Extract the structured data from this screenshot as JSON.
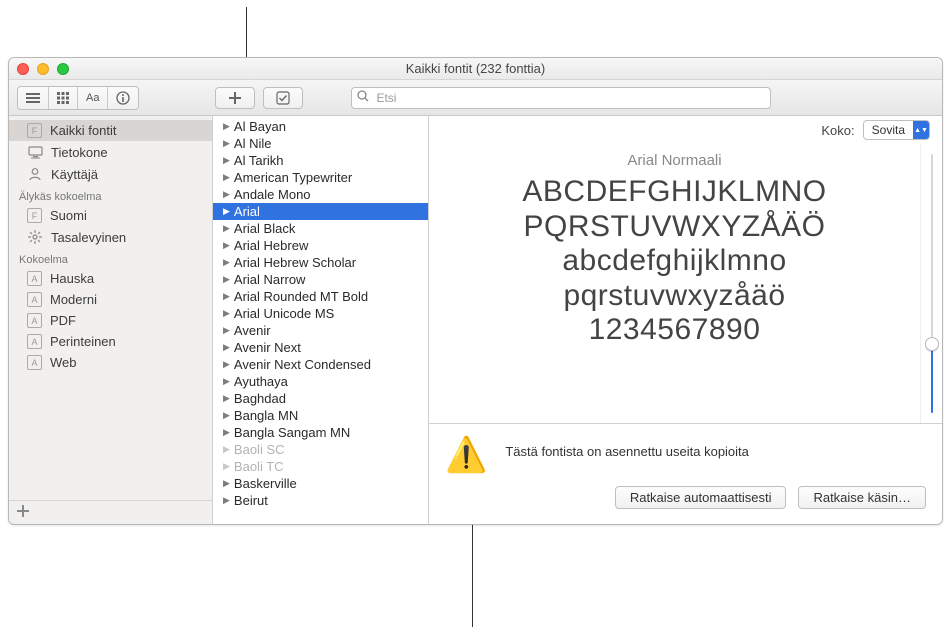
{
  "window": {
    "title": "Kaikki fontit (232 fonttia)"
  },
  "toolbar": {
    "search_placeholder": "Etsi"
  },
  "sidebar": {
    "groups": [
      {
        "header": null,
        "items": [
          {
            "icon": "F",
            "label": "Kaikki fontit",
            "selected": true,
            "name": "sidebar-item-all-fonts"
          },
          {
            "icon": "display",
            "label": "Tietokone",
            "name": "sidebar-item-computer"
          },
          {
            "icon": "user",
            "label": "Käyttäjä",
            "name": "sidebar-item-user"
          }
        ]
      },
      {
        "header": "Älykäs kokoelma",
        "items": [
          {
            "icon": "F",
            "label": "Suomi",
            "name": "sidebar-item-suomi"
          },
          {
            "icon": "gear",
            "label": "Tasalevyinen",
            "name": "sidebar-item-fixed-width"
          }
        ]
      },
      {
        "header": "Kokoelma",
        "items": [
          {
            "icon": "A",
            "label": "Hauska",
            "name": "sidebar-item-fun"
          },
          {
            "icon": "A",
            "label": "Moderni",
            "name": "sidebar-item-modern"
          },
          {
            "icon": "A",
            "label": "PDF",
            "name": "sidebar-item-pdf"
          },
          {
            "icon": "A",
            "label": "Perinteinen",
            "name": "sidebar-item-traditional"
          },
          {
            "icon": "A",
            "label": "Web",
            "name": "sidebar-item-web"
          }
        ]
      }
    ]
  },
  "fonts": [
    {
      "name": "Al Bayan"
    },
    {
      "name": "Al Nile"
    },
    {
      "name": "Al Tarikh"
    },
    {
      "name": "American Typewriter"
    },
    {
      "name": "Andale Mono"
    },
    {
      "name": "Arial",
      "selected": true
    },
    {
      "name": "Arial Black"
    },
    {
      "name": "Arial Hebrew"
    },
    {
      "name": "Arial Hebrew Scholar"
    },
    {
      "name": "Arial Narrow"
    },
    {
      "name": "Arial Rounded MT Bold"
    },
    {
      "name": "Arial Unicode MS"
    },
    {
      "name": "Avenir"
    },
    {
      "name": "Avenir Next"
    },
    {
      "name": "Avenir Next Condensed"
    },
    {
      "name": "Ayuthaya"
    },
    {
      "name": "Baghdad"
    },
    {
      "name": "Bangla MN"
    },
    {
      "name": "Bangla Sangam MN"
    },
    {
      "name": "Baoli SC",
      "disabled": true
    },
    {
      "name": "Baoli TC",
      "disabled": true
    },
    {
      "name": "Baskerville"
    },
    {
      "name": "Beirut"
    }
  ],
  "preview": {
    "size_label": "Koko:",
    "size_value": "Sovita",
    "font_name": "Arial Normaali",
    "sample": [
      "ABCDEFGHIJKLMNO",
      "PQRSTUVWXYZÅÄÖ",
      "abcdefghijklmno",
      "pqrstuvwxyzåäö",
      "1234567890"
    ]
  },
  "warning": {
    "message": "Tästä fontista on asennettu useita kopioita",
    "resolve_auto": "Ratkaise automaattisesti",
    "resolve_manual": "Ratkaise käsin…"
  }
}
